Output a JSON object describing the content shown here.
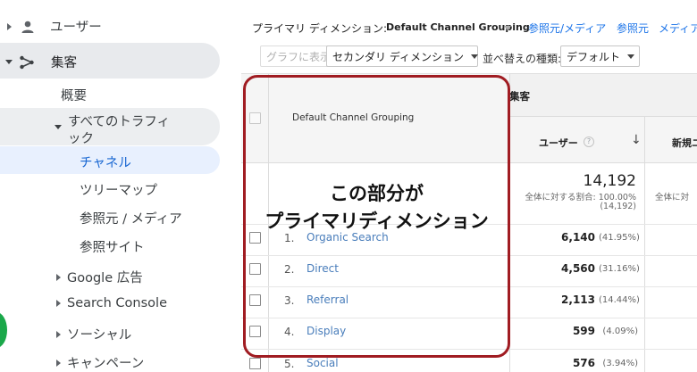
{
  "sidebar": {
    "users_label": "ユーザー",
    "acquisition_label": "集客",
    "overview_label": "概要",
    "all_traffic_line1": "すべてのトラフィ",
    "all_traffic_line2": "ック",
    "channels_label": "チャネル",
    "treemaps_label": "ツリーマップ",
    "source_medium_label": "参照元 / メディア",
    "referrals_label": "参照サイト",
    "google_ads_label": "Google 広告",
    "search_console_label": "Search Console",
    "social_label": "ソーシャル",
    "campaigns_label": "キャンペーン"
  },
  "topbar": {
    "primary_dimension_label": "プライマリ ディメンション:",
    "primary_dimension_value": "Default Channel Grouping",
    "link_source_medium": "参照元/メディア",
    "link_source": "参照元",
    "link_medium": "メディア"
  },
  "toolbar": {
    "graph_button": "グラフに表示",
    "secondary_dimension": "セカンダリ ディメンション",
    "sort_type_label": "並べ替えの種類:",
    "sort_value": "デフォルト"
  },
  "table": {
    "dimension_header": "Default Channel Grouping",
    "group_header": "集客",
    "users_header": "ユーザー",
    "help_icon_glyph": "?",
    "sort_arrow_glyph": "↓",
    "new_users_header": "新規ユ",
    "total_users": "14,192",
    "total_pct_label": "全体に対する割合: 100.00%",
    "total_paren": "(14,192)",
    "new_users_total_label": "全体に対",
    "rows": [
      {
        "rank": "1.",
        "channel": "Organic Search",
        "users": "6,140",
        "pct": "(41.95%)"
      },
      {
        "rank": "2.",
        "channel": "Direct",
        "users": "4,560",
        "pct": "(31.16%)"
      },
      {
        "rank": "3.",
        "channel": "Referral",
        "users": "2,113",
        "pct": "(14.44%)"
      },
      {
        "rank": "4.",
        "channel": "Display",
        "users": "599",
        "pct": "(4.09%)"
      },
      {
        "rank": "5.",
        "channel": "Social",
        "users": "576",
        "pct": "(3.94%)"
      }
    ]
  },
  "annotation": {
    "line1": "この部分が",
    "line2": "プライマリディメンション",
    "border_color": "#a01c22"
  },
  "colors": {
    "link": "#1a73e8",
    "channel_link": "#4a7ebb",
    "selected_pill": "#e8eaed",
    "active_item_bg": "#e8f0fe",
    "active_item_text": "#1967d2"
  }
}
